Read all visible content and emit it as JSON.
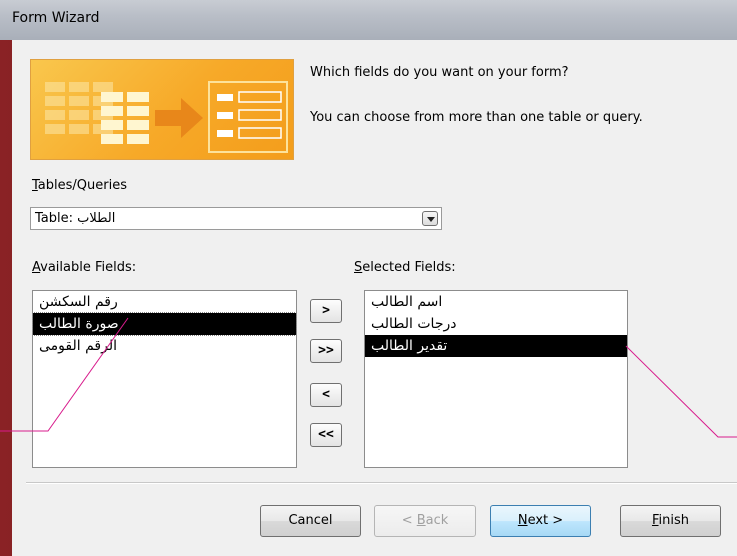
{
  "window": {
    "title": "Form Wizard"
  },
  "prompt": {
    "line1": "Which fields do you want on your form?",
    "line2": "You can choose from more than one table or query."
  },
  "tables_queries": {
    "label_accel": "T",
    "label_rest": "ables/Queries",
    "selected_value": "Table: الطلاب"
  },
  "available": {
    "label_accel": "A",
    "label_rest": "vailable Fields:",
    "items": [
      "رقم السكشن",
      "صورة الطالب",
      "الرقم القومى"
    ],
    "selected_index": 1
  },
  "selected": {
    "label_accel": "S",
    "label_rest": "elected Fields:",
    "items": [
      "اسم الطالب",
      "درجات الطالب",
      "تقدير الطالب"
    ],
    "selected_index": 2
  },
  "move_buttons": {
    "add_one": ">",
    "add_all": ">>",
    "remove_one": "<",
    "remove_all": "<<"
  },
  "footer": {
    "cancel": "Cancel",
    "back_pre": "< ",
    "back_accel": "B",
    "back_rest": "ack",
    "next_accel": "N",
    "next_rest": "ext >",
    "finish_accel": "F",
    "finish_rest": "inish"
  },
  "colors": {
    "frame": "#6e1618",
    "client": "#f0f0f0",
    "selection": "#000000",
    "callout_line": "#d81b8c",
    "graphic_orange": "#f7a928"
  },
  "icons": {
    "wizard_graphic": "table-to-form-graphic",
    "combo_arrow": "chevron-down-icon"
  }
}
